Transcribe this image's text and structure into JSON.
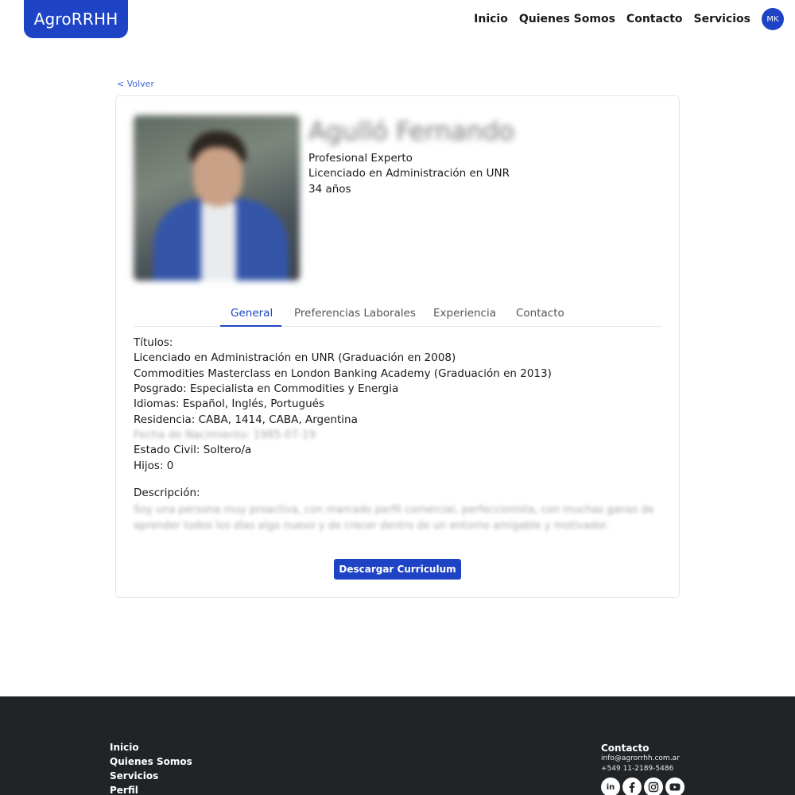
{
  "header": {
    "brand": "AgroRRHH",
    "nav": [
      "Inicio",
      "Quienes Somos",
      "Contacto",
      "Servicios"
    ],
    "avatar_initials": "MK"
  },
  "back_link": "< Volver",
  "profile": {
    "name": "Agulló Fernando",
    "level": "Profesional Experto",
    "degree": "Licenciado en Administración en UNR",
    "age": "34 años"
  },
  "tabs": [
    "General",
    "Preferencias Laborales",
    "Experiencia",
    "Contacto"
  ],
  "general": {
    "titles_label": "Títulos:",
    "title_1": "Licenciado en Administración en UNR (Graduación en 2008)",
    "title_2": "Commodities Masterclass en London Banking Academy (Graduación en 2013)",
    "postgrad": "Posgrado: Especialista en Commodities y Energia",
    "languages": "Idiomas: Español, Inglés, Portugués",
    "residence": "Residencia: CABA, 1414, CABA, Argentina",
    "birth": "Fecha de Nacimiento: 1985-07-19",
    "civil": "Estado Civil: Soltero/a",
    "children": "Hijos: 0",
    "description_label": "Descripción:",
    "description": "Soy una persona muy proactiva, con marcado perfil comercial, perfeccionista, con muchas ganas de aprender todos los días algo nuevo y de crecer dentro de un entorno amigable y motivador."
  },
  "download_button": "Descargar Curriculum",
  "footer": {
    "links": [
      "Inicio",
      "Quienes Somos",
      "Servicios",
      "Perfil"
    ],
    "contact_title": "Contacto",
    "email": "info@agrorrhh.com.ar",
    "phone": "+549 11-2189-5486",
    "social_icons": [
      "linkedin-icon",
      "facebook-icon",
      "instagram-icon",
      "youtube-icon"
    ]
  },
  "colors": {
    "accent": "#1e44c5",
    "footer_bg": "#212426"
  }
}
